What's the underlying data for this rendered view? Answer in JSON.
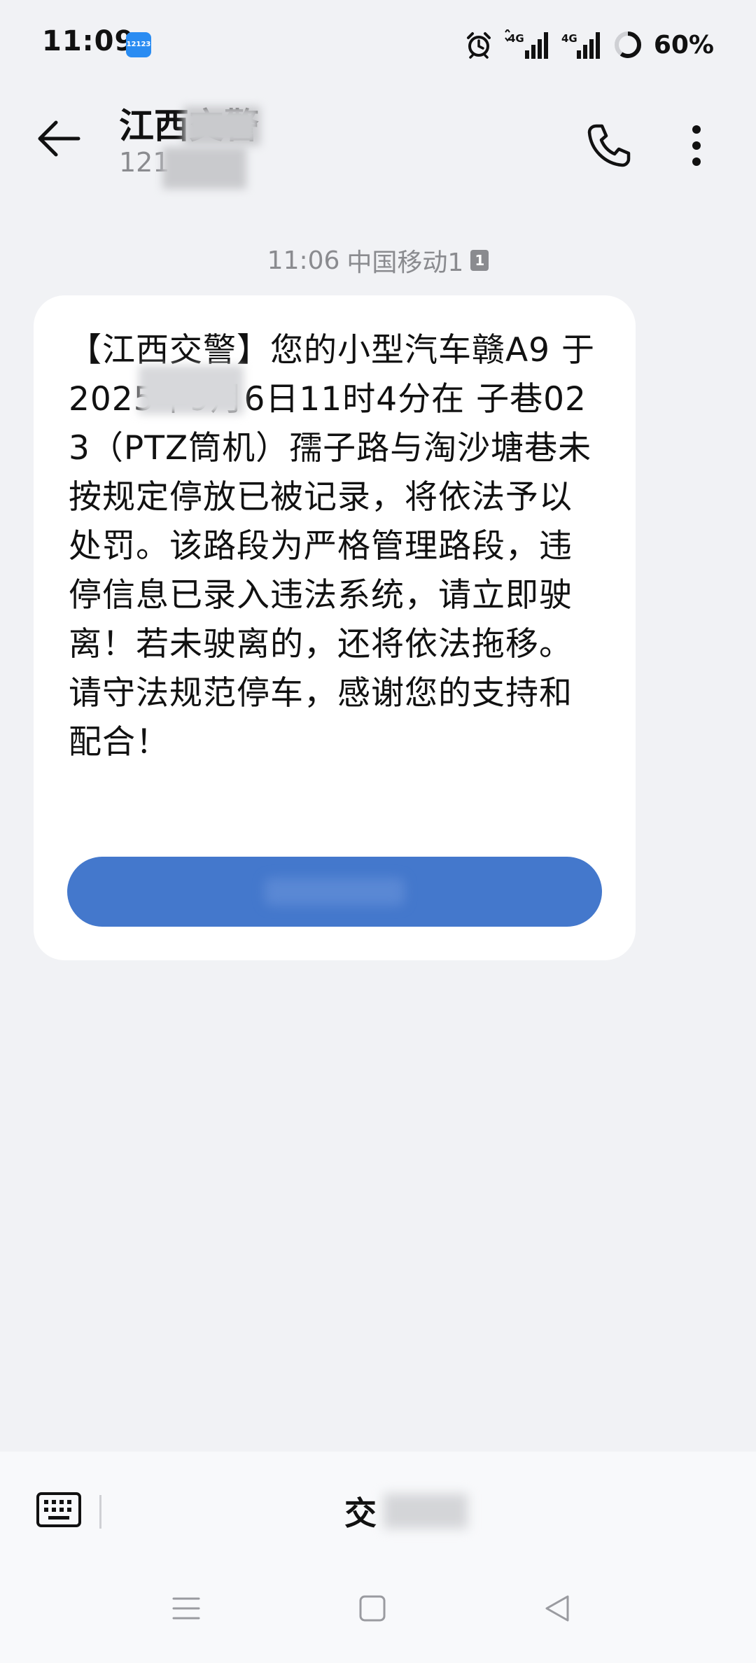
{
  "status_bar": {
    "time": "11:09",
    "app_badge": "12123",
    "network_1": "4G",
    "network_2": "4G",
    "battery": "60%"
  },
  "header": {
    "contact_name": "江西交警",
    "contact_number": "121"
  },
  "message": {
    "meta_time": "11:06",
    "meta_carrier": "中国移动1",
    "sim_slot": "1",
    "body": "【江西交警】您的小型汽车赣A9   于2025年9月6日11时4分在 子巷023（PTZ筒机）孺子路与淘沙塘巷未按规定停放已被记录，将依法予以处罚。该路段为严格管理路段，违停信息已录入违法系统，请立即驶离！若未驶离的，还将依法拖移。请守法规范停车，感谢您的支持和配合！"
  },
  "composer": {
    "text": "交"
  },
  "colors": {
    "background": "#f1f2f5",
    "bubble": "#ffffff",
    "action_button": "#4478cc",
    "app_icon": "#2a8cf2"
  },
  "icons": {
    "back": "arrow-left-icon",
    "call": "phone-icon",
    "more": "more-vertical-icon",
    "keyboard": "keyboard-icon",
    "alarm": "alarm-icon",
    "battery": "battery-ring-icon",
    "nav_menu": "menu-icon",
    "nav_home": "home-square-icon",
    "nav_back": "back-triangle-icon"
  }
}
